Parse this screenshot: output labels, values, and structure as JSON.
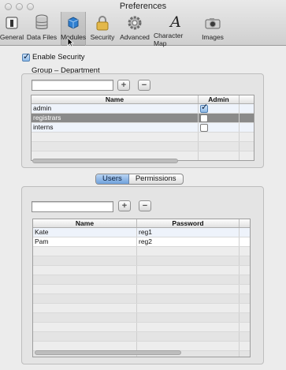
{
  "window": {
    "title": "Preferences"
  },
  "toolbar": {
    "items": [
      {
        "label": "General",
        "icon": "switch-icon"
      },
      {
        "label": "Data Files",
        "icon": "database-icon"
      },
      {
        "label": "Modules",
        "icon": "cube-icon"
      },
      {
        "label": "Security",
        "icon": "lock-icon"
      },
      {
        "label": "Advanced",
        "icon": "gear-icon"
      },
      {
        "label": "Character Map",
        "icon": "script-a-icon"
      },
      {
        "label": "Images",
        "icon": "camera-icon"
      }
    ],
    "selected": "Modules"
  },
  "security": {
    "enable_label": "Enable Security",
    "enabled": true,
    "group_label": "Group – Department",
    "group_search": {
      "value": "",
      "placeholder": ""
    },
    "add_symbol": "+",
    "remove_symbol": "−",
    "groups_table": {
      "columns": [
        "Name",
        "Admin"
      ],
      "rows": [
        {
          "name": "admin",
          "admin": true
        },
        {
          "name": "registrars",
          "admin": false
        },
        {
          "name": "interns",
          "admin": false
        }
      ],
      "selected_row": 1
    }
  },
  "segmented": {
    "tabs": [
      "Users",
      "Permissions"
    ],
    "active": "Users"
  },
  "users": {
    "search": {
      "value": "",
      "placeholder": ""
    },
    "table": {
      "columns": [
        "Name",
        "Password"
      ],
      "rows": [
        {
          "name": "Kate",
          "password": "reg1"
        },
        {
          "name": "Pam",
          "password": "reg2"
        }
      ]
    }
  },
  "colors": {
    "selection_gray": "#8a8a8a",
    "accent_blue": "#6fa1dc"
  }
}
